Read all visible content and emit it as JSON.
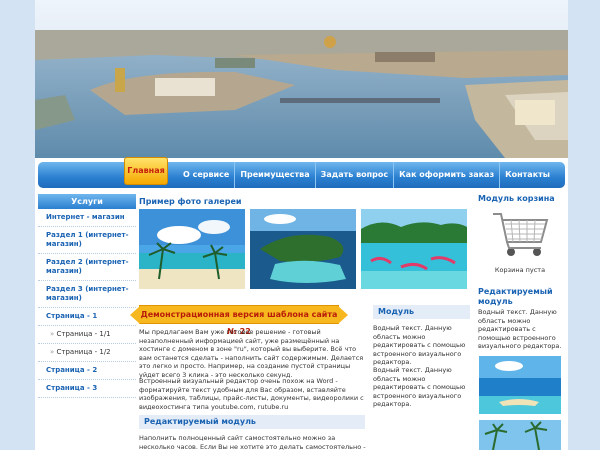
{
  "nav": {
    "active": "Главная",
    "items": [
      "О сервисе",
      "Преимущества",
      "Задать вопрос",
      "Как оформить заказ",
      "Контакты"
    ]
  },
  "left": {
    "title": "Услуги",
    "items": [
      {
        "label": "Интернет - магазин",
        "sub": false
      },
      {
        "label": "Раздел 1 (интернет-магазин)",
        "sub": false
      },
      {
        "label": "Раздел 2 (интернет-магазин)",
        "sub": false
      },
      {
        "label": "Раздел 3 (интернет-магазин)",
        "sub": false
      },
      {
        "label": "Страница - 1",
        "sub": false
      },
      {
        "label": "Страница - 1/1",
        "sub": true
      },
      {
        "label": "Страница - 1/2",
        "sub": true
      },
      {
        "label": "Страница - 2",
        "sub": false
      },
      {
        "label": "Страница - 3",
        "sub": false
      }
    ]
  },
  "gallery": {
    "title": "Пример фото галереи"
  },
  "banner": "Демонстрационная версия шаблона сайта № 22",
  "main": {
    "p1": "Мы предлагаем Вам уже готовое решение - готовый незаполненный информацией сайт, уже размещённый на хостинге с доменом в зоне \"ru\", который вы выберите. Всё что вам останется сделать - наполнить сайт содержимым. Делается это легко и просто. Например, на создание пустой страницы уйдет всего 3 клика - это несколько секунд.",
    "p2": "Встроенный визуальный редактор очень похож на Word - форматируйте текст удобным для Вас образом, вставляйте изображения, таблицы, прайс-листы, документы, видеоролики с видеохостинга типа youtube.com, rutube.ru",
    "editable_title": "Редактируемый модуль",
    "p3": "Наполнить полноценный сайт самостоятельно можно за несколько часов. Если Вы не хотите это делать самостоятельно - наши"
  },
  "module": {
    "title": "Модуль",
    "p1": "Водный текст. Данную область можно редактировать с помощью встроенного визуального редактора.",
    "p2": "Водный текст. Данную область можно редактировать с помощью встроенного визуального редактора."
  },
  "right": {
    "cart_title": "Модуль корзина",
    "cart_empty": "Корзина пуста",
    "editable_title": "Редактируемый модуль",
    "text": "Водный текст. Данную область можно редактировать с помощью встроенного визуального редактора."
  }
}
